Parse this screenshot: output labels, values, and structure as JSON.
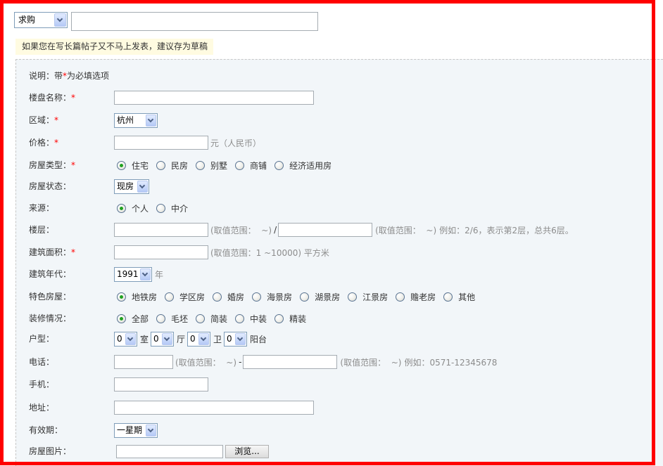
{
  "header": {
    "category_select": "求购",
    "title_input": ""
  },
  "draft_tip": "如果您在写长篇帖子又不马上发表，建议存为草稿",
  "note": {
    "before": "说明：带",
    "star": "*",
    "after": "为必填选项"
  },
  "fields": {
    "estate_name": {
      "label": "楼盘名称：",
      "required": "*",
      "value": ""
    },
    "region": {
      "label": "区域：",
      "required": "*",
      "value": "杭州"
    },
    "price": {
      "label": "价格：",
      "required": "*",
      "value": "",
      "unit": "元（人民币）"
    },
    "house_type": {
      "label": "房屋类型：",
      "required": "*",
      "options": [
        {
          "label": "住宅",
          "checked": true
        },
        {
          "label": "民房",
          "checked": false
        },
        {
          "label": "别墅",
          "checked": false
        },
        {
          "label": "商铺",
          "checked": false
        },
        {
          "label": "经济适用房",
          "checked": false
        }
      ]
    },
    "status": {
      "label": "房屋状态：",
      "value": "现房"
    },
    "source": {
      "label": "来源：",
      "options": [
        {
          "label": "个人",
          "checked": true
        },
        {
          "label": "中介",
          "checked": false
        }
      ]
    },
    "floor": {
      "label": "楼层：",
      "current": "",
      "current_range": "(取值范围：  ~)",
      "separator": "/",
      "total": "",
      "total_range": "(取值范围：  ~)",
      "example": "例如：2/6，表示第2层，总共6层。"
    },
    "area": {
      "label": "建筑面积：",
      "required": "*",
      "value": "",
      "hint": "(取值范围：1 ~10000) 平方米"
    },
    "build_year": {
      "label": "建筑年代：",
      "value": "1991",
      "unit": "年"
    },
    "feature": {
      "label": "特色房屋：",
      "options": [
        {
          "label": "地铁房",
          "checked": true
        },
        {
          "label": "学区房",
          "checked": false
        },
        {
          "label": "婚房",
          "checked": false
        },
        {
          "label": "海景房",
          "checked": false
        },
        {
          "label": "湖景房",
          "checked": false
        },
        {
          "label": "江景房",
          "checked": false
        },
        {
          "label": "赡老房",
          "checked": false
        },
        {
          "label": "其他",
          "checked": false
        }
      ]
    },
    "decoration": {
      "label": "装修情况：",
      "options": [
        {
          "label": "全部",
          "checked": true
        },
        {
          "label": "毛坯",
          "checked": false
        },
        {
          "label": "简装",
          "checked": false
        },
        {
          "label": "中装",
          "checked": false
        },
        {
          "label": "精装",
          "checked": false
        }
      ]
    },
    "layout": {
      "label": "户型：",
      "parts": [
        {
          "value": "0",
          "unit": "室"
        },
        {
          "value": "0",
          "unit": "厅"
        },
        {
          "value": "0",
          "unit": "卫"
        },
        {
          "value": "0",
          "unit": "阳台"
        }
      ]
    },
    "phone": {
      "label": "电话：",
      "area_code": "",
      "area_code_range": "(取值范围：  ~)",
      "separator": "-",
      "number": "",
      "number_range": "(取值范围：  ~)",
      "example": "例如：0571-12345678"
    },
    "mobile": {
      "label": "手机：",
      "value": ""
    },
    "address": {
      "label": "地址：",
      "value": ""
    },
    "validity": {
      "label": "有效期：",
      "value": "一星期"
    },
    "photo": {
      "label": "房屋图片：",
      "value": "",
      "browse_label": "浏览..."
    }
  },
  "colors": {
    "frame": "#ff0000",
    "required": "#ff0000",
    "tip_background": "#fffbe1",
    "form_background": "#f2f6f9",
    "hint_text": "#8c8c8c",
    "radio_checked": "#21a121"
  },
  "icons": {
    "select_arrow": "chevron-down-icon"
  }
}
